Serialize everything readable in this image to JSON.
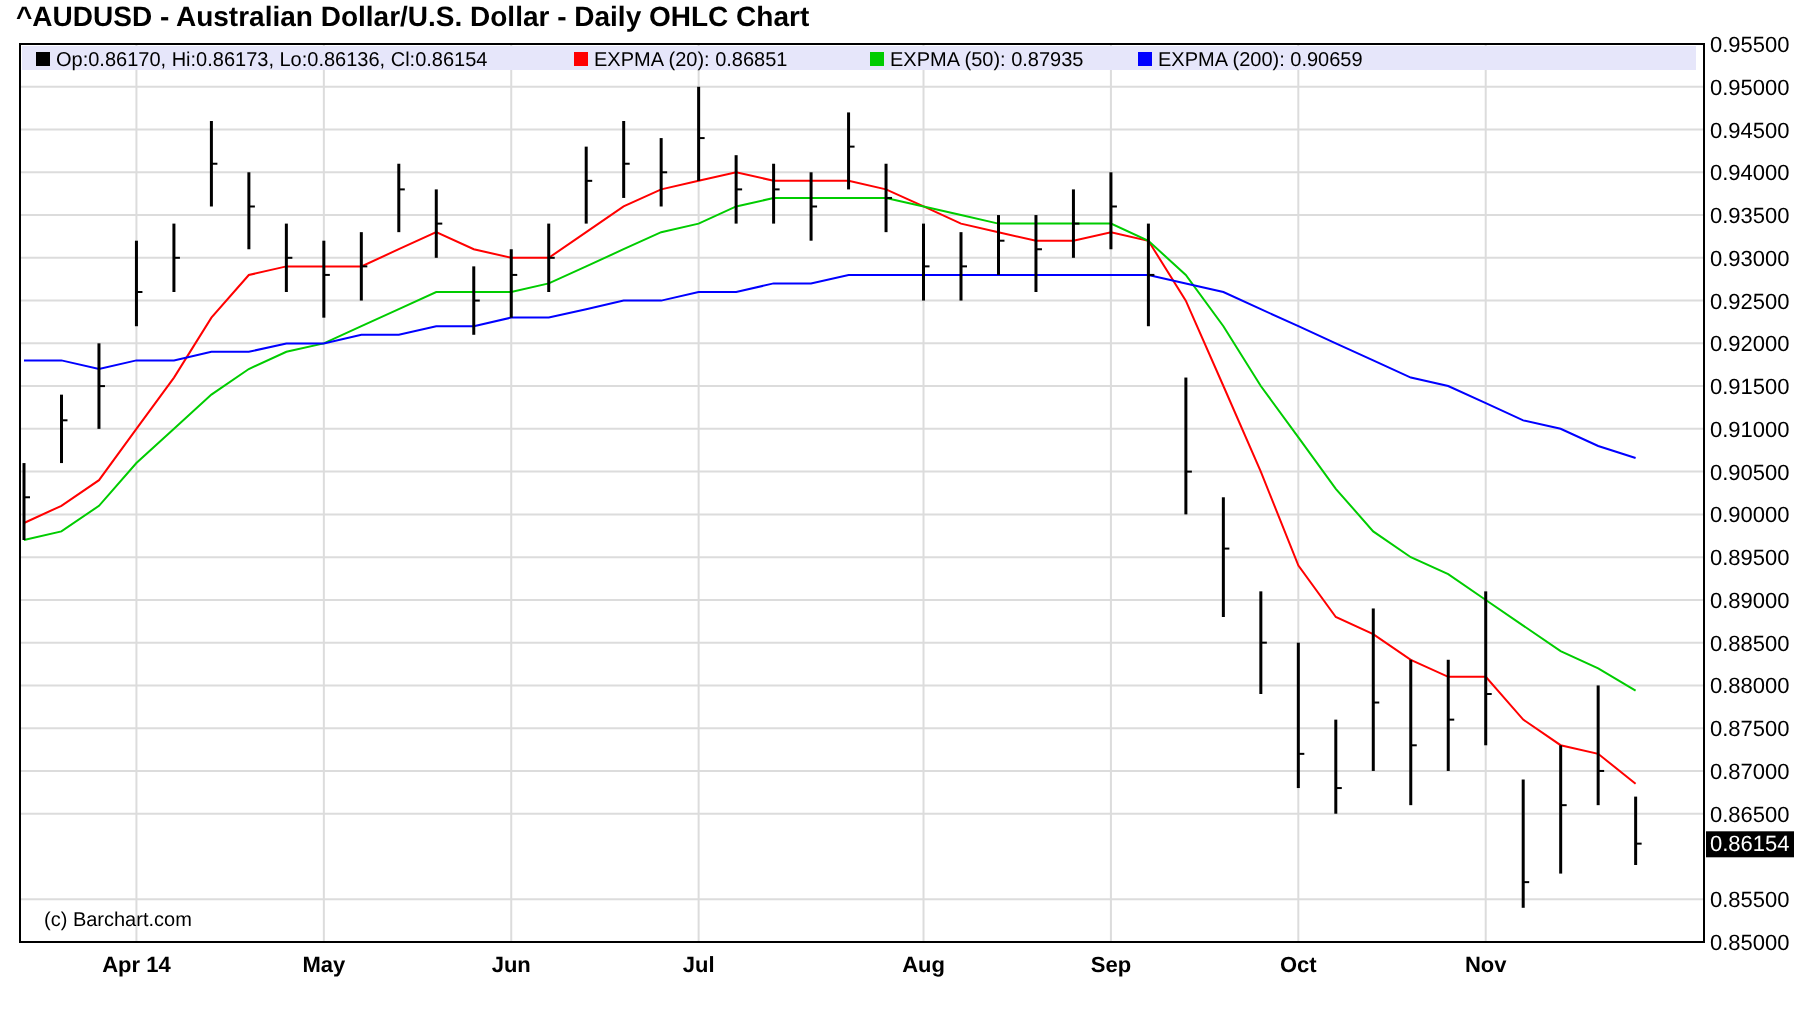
{
  "title": "^AUDUSD - Australian Dollar/U.S. Dollar - Daily OHLC Chart",
  "chart": {
    "legend": [
      {
        "text": "Op:0.86170, Hi:0.86173, Lo:0.86136, Cl:0.86154",
        "color": "#000000"
      },
      {
        "text": "EXPMA (20): 0.86851",
        "color": "#ff0000"
      },
      {
        "text": "EXPMA (50): 0.87935",
        "color": "#00cc00"
      },
      {
        "text": "EXPMA (200): 0.90659",
        "color": "#0000ff"
      }
    ],
    "source": "(c) Barchart.com",
    "last_price": "0.86154",
    "chart_data": {
      "type": "line",
      "categories": [
        null,
        null,
        null,
        "Apr 14",
        null,
        null,
        null,
        null,
        "May",
        null,
        null,
        null,
        null,
        "Jun",
        null,
        null,
        null,
        null,
        "Jul",
        null,
        null,
        null,
        null,
        null,
        "Aug",
        null,
        null,
        null,
        null,
        "Sep",
        null,
        null,
        null,
        null,
        "Oct",
        null,
        null,
        null,
        null,
        "Nov",
        null,
        null,
        null,
        null
      ],
      "series": [
        {
          "color": "#ff0000",
          "values": [
            0.899,
            0.901,
            0.904,
            0.91,
            0.916,
            0.923,
            0.928,
            0.929,
            0.929,
            0.929,
            0.931,
            0.933,
            0.931,
            0.93,
            0.93,
            0.933,
            0.936,
            0.938,
            0.939,
            0.94,
            0.939,
            0.939,
            0.939,
            0.938,
            0.936,
            0.934,
            0.933,
            0.932,
            0.932,
            0.933,
            0.932,
            0.925,
            0.915,
            0.905,
            0.894,
            0.888,
            0.886,
            0.883,
            0.881,
            0.881,
            0.876,
            0.873,
            0.872,
            0.8685
          ]
        },
        {
          "color": "#00cc00",
          "values": [
            0.897,
            0.898,
            0.901,
            0.906,
            0.91,
            0.914,
            0.917,
            0.919,
            0.92,
            0.922,
            0.924,
            0.926,
            0.926,
            0.926,
            0.927,
            0.929,
            0.931,
            0.933,
            0.934,
            0.936,
            0.937,
            0.937,
            0.937,
            0.937,
            0.936,
            0.935,
            0.934,
            0.934,
            0.934,
            0.934,
            0.932,
            0.928,
            0.922,
            0.915,
            0.909,
            0.903,
            0.898,
            0.895,
            0.893,
            0.89,
            0.887,
            0.884,
            0.882,
            0.8794
          ]
        },
        {
          "color": "#0000ff",
          "values": [
            0.918,
            0.918,
            0.917,
            0.918,
            0.918,
            0.919,
            0.919,
            0.92,
            0.92,
            0.921,
            0.921,
            0.922,
            0.922,
            0.923,
            0.923,
            0.924,
            0.925,
            0.925,
            0.926,
            0.926,
            0.927,
            0.927,
            0.928,
            0.928,
            0.928,
            0.928,
            0.928,
            0.928,
            0.928,
            0.928,
            0.928,
            0.927,
            0.926,
            0.924,
            0.922,
            0.92,
            0.918,
            0.916,
            0.915,
            0.913,
            0.911,
            0.91,
            0.908,
            0.9066
          ]
        }
      ],
      "ylim": [
        0.85,
        0.955
      ],
      "grid": true,
      "yticks": [
        {
          "value": 0.955,
          "label": "0.95500"
        },
        {
          "value": 0.95,
          "label": "0.95000"
        },
        {
          "value": 0.945,
          "label": "0.94500"
        },
        {
          "value": 0.94,
          "label": "0.94000"
        },
        {
          "value": 0.935,
          "label": "0.93500"
        },
        {
          "value": 0.93,
          "label": "0.93000"
        },
        {
          "value": 0.925,
          "label": "0.92500"
        },
        {
          "value": 0.92,
          "label": "0.92000"
        },
        {
          "value": 0.915,
          "label": "0.91500"
        },
        {
          "value": 0.91,
          "label": "0.91000"
        },
        {
          "value": 0.905,
          "label": "0.90500"
        },
        {
          "value": 0.9,
          "label": "0.90000"
        },
        {
          "value": 0.895,
          "label": "0.89500"
        },
        {
          "value": 0.89,
          "label": "0.89000"
        },
        {
          "value": 0.885,
          "label": "0.88500"
        },
        {
          "value": 0.88,
          "label": "0.88000"
        },
        {
          "value": 0.875,
          "label": "0.87500"
        },
        {
          "value": 0.87,
          "label": "0.87000"
        },
        {
          "value": 0.865,
          "label": "0.86500"
        },
        {
          "value": 0.855,
          "label": "0.85500"
        },
        {
          "value": 0.85,
          "label": "0.85000"
        }
      ]
    }
  }
}
